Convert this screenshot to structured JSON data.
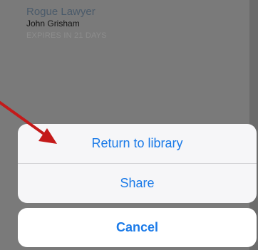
{
  "book": {
    "title": "Rogue Lawyer",
    "author": "John Grisham",
    "expiry": "EXPIRES IN 21 DAYS"
  },
  "action_sheet": {
    "return_label": "Return to library",
    "share_label": "Share",
    "cancel_label": "Cancel"
  },
  "colors": {
    "action_text": "#1a7ae8",
    "arrow": "#c41a1a"
  },
  "annotation": {
    "icon": "arrow-icon"
  }
}
